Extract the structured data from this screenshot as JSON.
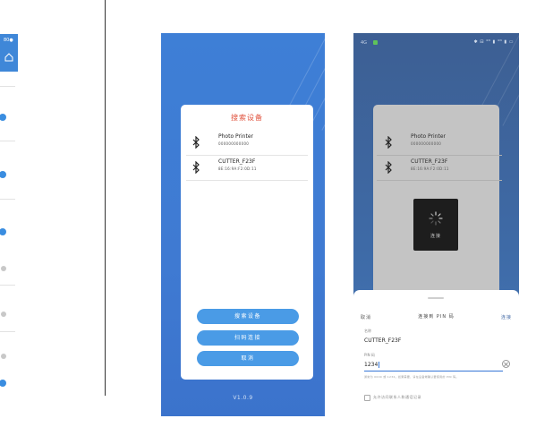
{
  "left_phone": {
    "status": "80●"
  },
  "phone1": {
    "dialog_title": "搜索设备",
    "devices": [
      {
        "name": "Photo Printer",
        "mac": "000000000000"
      },
      {
        "name": "CUTTER_F23F",
        "mac": "8E:16:9A:F2:0D:11"
      }
    ],
    "buttons": [
      "搜索设备",
      "扫码连接",
      "取消"
    ],
    "version": "V1.0.9"
  },
  "phone2": {
    "status_left": "4G",
    "status_right": "✱ ⊟ ⁴ᴳ ▮ ⁴ᴳ ▮ ▭",
    "devices": [
      {
        "name": "Photo Printer",
        "mac": "000000000000"
      },
      {
        "name": "CUTTER_F23F",
        "mac": "8E:16:9A:F2:0D:11"
      }
    ],
    "loading_label": "连接",
    "sheet": {
      "cancel": "取消",
      "title": "连接到 PIN 码",
      "confirm": "连接",
      "name_label": "名称",
      "name_value": "CUTTER_F23F",
      "pwd_label": "PIN 码",
      "pwd_value": "1234",
      "hint": "通常为 0000 或 1234。如果需要，请在设备端确认要使用的 PIN 码。",
      "checkbox_label": "允许访问联系人和通话记录"
    }
  },
  "colors": {
    "accent_blue": "#3f7ad2",
    "button_blue": "#4a9be6",
    "title_red": "#e0513c"
  }
}
